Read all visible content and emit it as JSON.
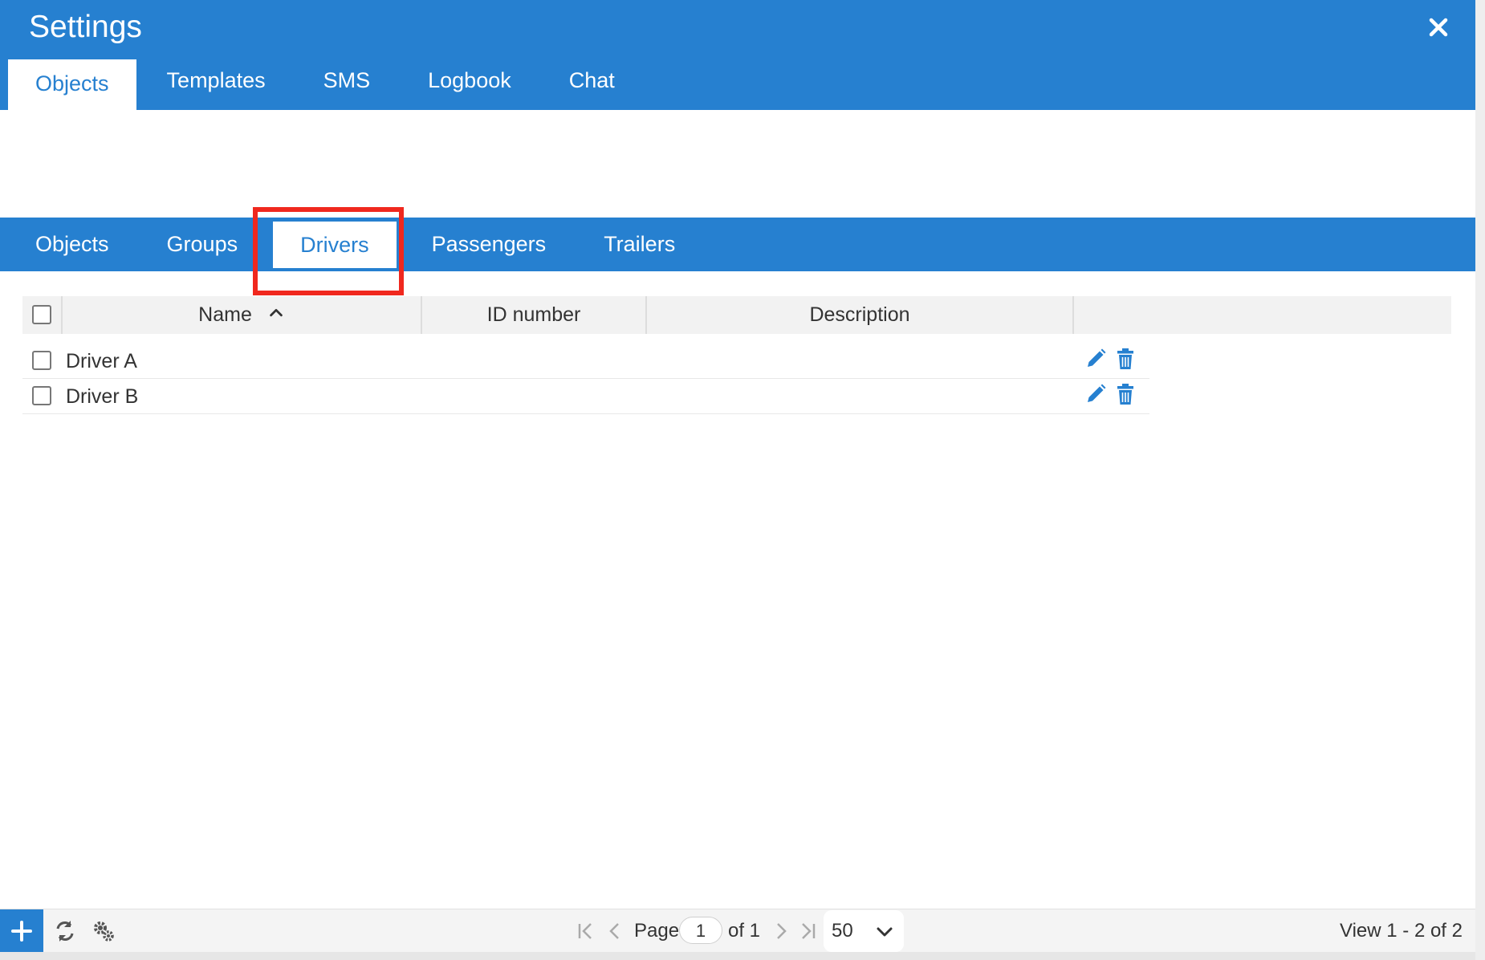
{
  "window": {
    "title": "Settings",
    "close_icon": "close-icon"
  },
  "top_tabs": [
    {
      "label": "Objects",
      "active": true
    },
    {
      "label": "Templates",
      "active": false
    },
    {
      "label": "SMS",
      "active": false
    },
    {
      "label": "Logbook",
      "active": false
    },
    {
      "label": "Chat",
      "active": false
    }
  ],
  "sub_tabs": [
    {
      "label": "Objects",
      "active": false
    },
    {
      "label": "Groups",
      "active": false
    },
    {
      "label": "Drivers",
      "active": true
    },
    {
      "label": "Passengers",
      "active": false
    },
    {
      "label": "Trailers",
      "active": false
    }
  ],
  "grid": {
    "columns": {
      "name": "Name",
      "id_number": "ID number",
      "description": "Description"
    },
    "sort_icon": "chevron-up-icon",
    "rows": [
      {
        "name": "Driver A",
        "id_number": "",
        "description": ""
      },
      {
        "name": "Driver B",
        "id_number": "",
        "description": ""
      }
    ]
  },
  "footer": {
    "page_label": "Page",
    "page_value": "1",
    "of_label": "of 1",
    "per_page": "50",
    "view_text": "View 1 - 2 of 2"
  },
  "colors": {
    "accent": "#2680d0",
    "highlight": "#f0281e"
  }
}
